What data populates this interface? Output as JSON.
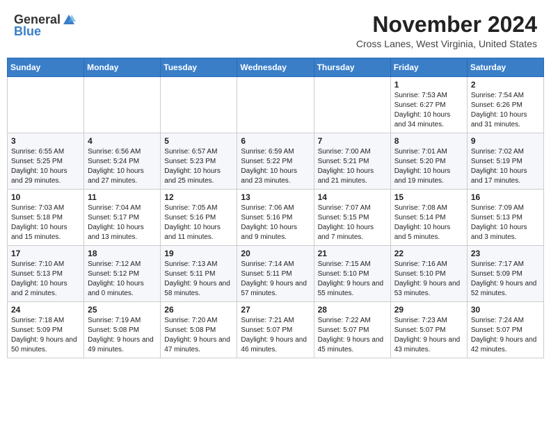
{
  "header": {
    "logo_general": "General",
    "logo_blue": "Blue",
    "month_title": "November 2024",
    "location": "Cross Lanes, West Virginia, United States"
  },
  "days_of_week": [
    "Sunday",
    "Monday",
    "Tuesday",
    "Wednesday",
    "Thursday",
    "Friday",
    "Saturday"
  ],
  "weeks": [
    [
      {
        "day": "",
        "info": ""
      },
      {
        "day": "",
        "info": ""
      },
      {
        "day": "",
        "info": ""
      },
      {
        "day": "",
        "info": ""
      },
      {
        "day": "",
        "info": ""
      },
      {
        "day": "1",
        "info": "Sunrise: 7:53 AM\nSunset: 6:27 PM\nDaylight: 10 hours and 34 minutes."
      },
      {
        "day": "2",
        "info": "Sunrise: 7:54 AM\nSunset: 6:26 PM\nDaylight: 10 hours and 31 minutes."
      }
    ],
    [
      {
        "day": "3",
        "info": "Sunrise: 6:55 AM\nSunset: 5:25 PM\nDaylight: 10 hours and 29 minutes."
      },
      {
        "day": "4",
        "info": "Sunrise: 6:56 AM\nSunset: 5:24 PM\nDaylight: 10 hours and 27 minutes."
      },
      {
        "day": "5",
        "info": "Sunrise: 6:57 AM\nSunset: 5:23 PM\nDaylight: 10 hours and 25 minutes."
      },
      {
        "day": "6",
        "info": "Sunrise: 6:59 AM\nSunset: 5:22 PM\nDaylight: 10 hours and 23 minutes."
      },
      {
        "day": "7",
        "info": "Sunrise: 7:00 AM\nSunset: 5:21 PM\nDaylight: 10 hours and 21 minutes."
      },
      {
        "day": "8",
        "info": "Sunrise: 7:01 AM\nSunset: 5:20 PM\nDaylight: 10 hours and 19 minutes."
      },
      {
        "day": "9",
        "info": "Sunrise: 7:02 AM\nSunset: 5:19 PM\nDaylight: 10 hours and 17 minutes."
      }
    ],
    [
      {
        "day": "10",
        "info": "Sunrise: 7:03 AM\nSunset: 5:18 PM\nDaylight: 10 hours and 15 minutes."
      },
      {
        "day": "11",
        "info": "Sunrise: 7:04 AM\nSunset: 5:17 PM\nDaylight: 10 hours and 13 minutes."
      },
      {
        "day": "12",
        "info": "Sunrise: 7:05 AM\nSunset: 5:16 PM\nDaylight: 10 hours and 11 minutes."
      },
      {
        "day": "13",
        "info": "Sunrise: 7:06 AM\nSunset: 5:16 PM\nDaylight: 10 hours and 9 minutes."
      },
      {
        "day": "14",
        "info": "Sunrise: 7:07 AM\nSunset: 5:15 PM\nDaylight: 10 hours and 7 minutes."
      },
      {
        "day": "15",
        "info": "Sunrise: 7:08 AM\nSunset: 5:14 PM\nDaylight: 10 hours and 5 minutes."
      },
      {
        "day": "16",
        "info": "Sunrise: 7:09 AM\nSunset: 5:13 PM\nDaylight: 10 hours and 3 minutes."
      }
    ],
    [
      {
        "day": "17",
        "info": "Sunrise: 7:10 AM\nSunset: 5:13 PM\nDaylight: 10 hours and 2 minutes."
      },
      {
        "day": "18",
        "info": "Sunrise: 7:12 AM\nSunset: 5:12 PM\nDaylight: 10 hours and 0 minutes."
      },
      {
        "day": "19",
        "info": "Sunrise: 7:13 AM\nSunset: 5:11 PM\nDaylight: 9 hours and 58 minutes."
      },
      {
        "day": "20",
        "info": "Sunrise: 7:14 AM\nSunset: 5:11 PM\nDaylight: 9 hours and 57 minutes."
      },
      {
        "day": "21",
        "info": "Sunrise: 7:15 AM\nSunset: 5:10 PM\nDaylight: 9 hours and 55 minutes."
      },
      {
        "day": "22",
        "info": "Sunrise: 7:16 AM\nSunset: 5:10 PM\nDaylight: 9 hours and 53 minutes."
      },
      {
        "day": "23",
        "info": "Sunrise: 7:17 AM\nSunset: 5:09 PM\nDaylight: 9 hours and 52 minutes."
      }
    ],
    [
      {
        "day": "24",
        "info": "Sunrise: 7:18 AM\nSunset: 5:09 PM\nDaylight: 9 hours and 50 minutes."
      },
      {
        "day": "25",
        "info": "Sunrise: 7:19 AM\nSunset: 5:08 PM\nDaylight: 9 hours and 49 minutes."
      },
      {
        "day": "26",
        "info": "Sunrise: 7:20 AM\nSunset: 5:08 PM\nDaylight: 9 hours and 47 minutes."
      },
      {
        "day": "27",
        "info": "Sunrise: 7:21 AM\nSunset: 5:07 PM\nDaylight: 9 hours and 46 minutes."
      },
      {
        "day": "28",
        "info": "Sunrise: 7:22 AM\nSunset: 5:07 PM\nDaylight: 9 hours and 45 minutes."
      },
      {
        "day": "29",
        "info": "Sunrise: 7:23 AM\nSunset: 5:07 PM\nDaylight: 9 hours and 43 minutes."
      },
      {
        "day": "30",
        "info": "Sunrise: 7:24 AM\nSunset: 5:07 PM\nDaylight: 9 hours and 42 minutes."
      }
    ]
  ]
}
